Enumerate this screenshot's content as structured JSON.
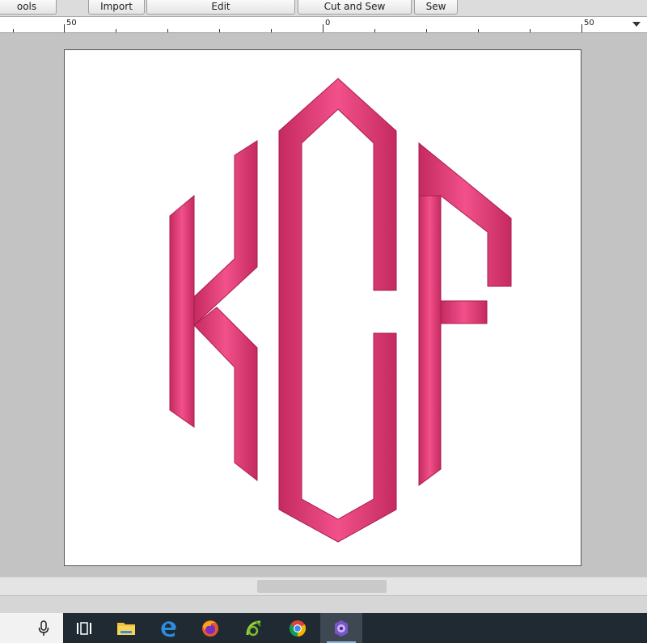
{
  "toolbar": {
    "tabs": [
      {
        "label": "ools"
      },
      {
        "label": "Import"
      },
      {
        "label": "Edit"
      },
      {
        "label": "Cut and Sew"
      },
      {
        "label": "Sew"
      }
    ]
  },
  "ruler": {
    "labels": [
      "50",
      "0",
      "50"
    ]
  },
  "design": {
    "monogram_text": "KCF",
    "thread_color": "#e8447a"
  },
  "taskbar": {
    "icons": [
      "microphone-icon",
      "task-view-icon",
      "file-explorer-icon",
      "edge-browser-icon",
      "firefox-icon",
      "embroidery-app-icon",
      "chrome-icon",
      "active-embroidery-software-icon"
    ]
  }
}
